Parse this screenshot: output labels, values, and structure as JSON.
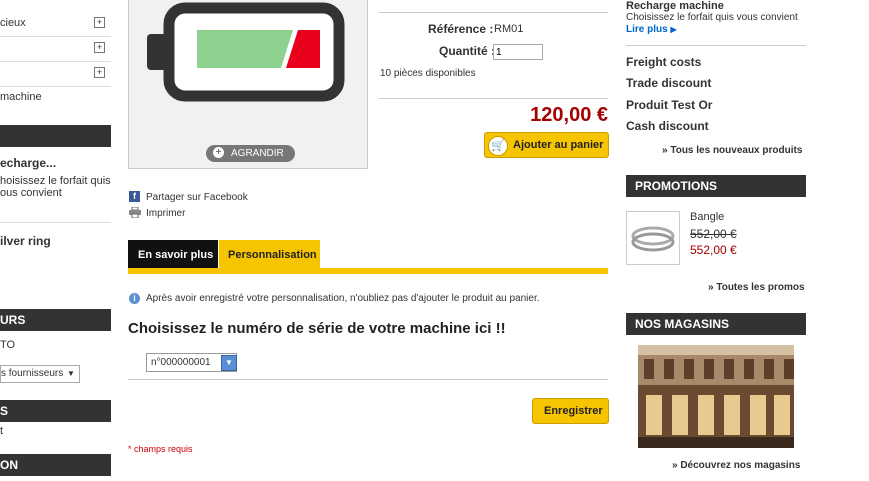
{
  "left": {
    "cat_items": [
      {
        "label": "cieux"
      },
      {
        "label": ""
      },
      {
        "label": ""
      }
    ],
    "machine_label": "machine",
    "recharge_title": "echarge...",
    "recharge_desc_1": "hoisissez le forfait quis",
    "recharge_desc_2": "ous convient",
    "silver_ring": "ilver ring",
    "head_1": "URS",
    "to_label": "TO",
    "suppliers_select": "s fournisseurs",
    "head_2": "S",
    "t_label": "t",
    "head_3": "ON"
  },
  "product": {
    "enlarge_label": "AGRANDIR",
    "reference_label": "Référence :",
    "reference_value": "RM01",
    "quantity_label": "Quantité :",
    "quantity_value": "1",
    "stock_text": "10 pièces disponibles",
    "price": "120,00 €",
    "add_to_cart": "Ajouter au panier",
    "share_facebook": "Partager sur Facebook",
    "print": "Imprimer"
  },
  "tabs": [
    {
      "label": "En savoir plus"
    },
    {
      "label": "Personnalisation"
    }
  ],
  "customization": {
    "info_text": "Après avoir enregistré votre personnalisation, n'oubliez pas d'ajouter le produit au panier.",
    "heading": "Choisissez le numéro de série de votre machine ici !!",
    "serial_value": "n°000000001",
    "save_button": "Enregistrer",
    "required_note": "* champs requis"
  },
  "right": {
    "recharge_title": "Recharge machine",
    "recharge_desc": "Choisissez le forfait quis vous convient",
    "read_more": "Lire plus",
    "links": [
      "Freight costs",
      "Trade discount",
      "Produit Test Or",
      "Cash discount"
    ],
    "all_new": "» Tous les nouveaux produits",
    "promotions_head": "PROMOTIONS",
    "promo_name": "Bangle",
    "promo_old_price": "552,00 €",
    "promo_new_price": "552,00 €",
    "all_promos": "» Toutes les promos",
    "stores_head": "NOS MAGASINS",
    "discover_stores": "» Découvrez nos magasins"
  },
  "colors": {
    "accent_yellow": "#f7c400",
    "price_red": "#a50000",
    "dark_bar": "#333333",
    "link_blue": "#0066cc"
  }
}
